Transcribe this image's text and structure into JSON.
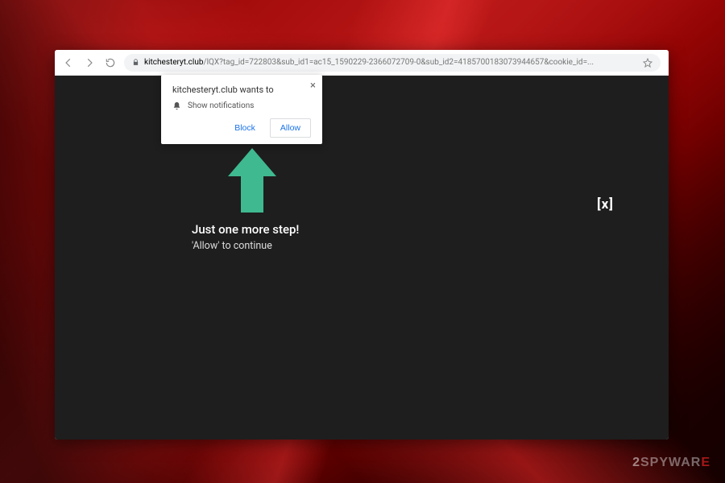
{
  "url": {
    "domain": "kitchesteryt.club",
    "path": "/lQX?tag_id=722803&sub_id1=ac15_1590229-2366072709-0&sub_id2=4185700183073944657&cookie_id=..."
  },
  "notification": {
    "title": "kitchesteryt.club wants to",
    "permission_label": "Show notifications",
    "block_label": "Block",
    "allow_label": "Allow"
  },
  "page": {
    "prompt_title": "Just one more step!",
    "prompt_sub": "'Allow' to continue",
    "close_label": "[x]"
  },
  "watermark": {
    "prefix": "2",
    "mid": "SPYWAR",
    "suffix": "E"
  },
  "colors": {
    "arrow": "#3fb98f",
    "page_bg": "#1e1e1e",
    "link_blue": "#1a73e8"
  }
}
